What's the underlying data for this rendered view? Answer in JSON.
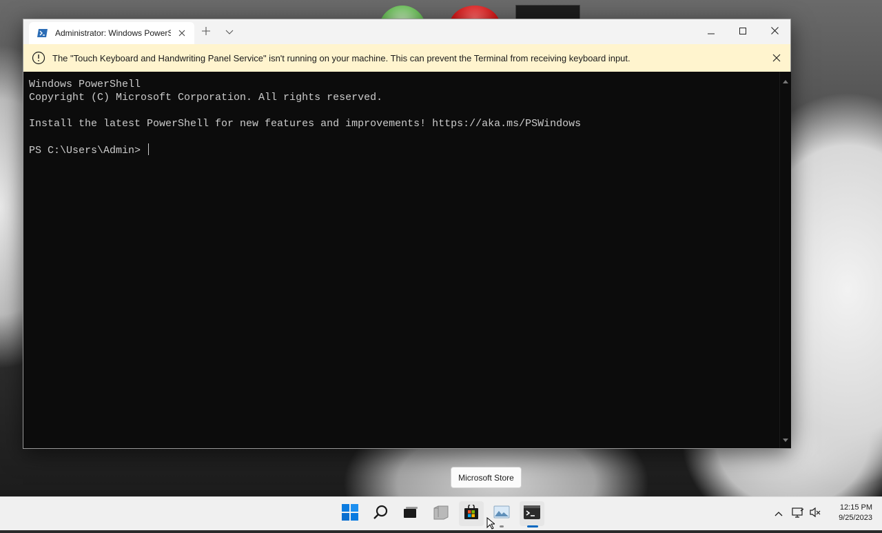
{
  "window": {
    "tab_title": "Administrator: Windows PowerShell",
    "controls": {
      "minimize": "minimize",
      "maximize": "maximize",
      "close": "close"
    }
  },
  "infobar": {
    "message": "The \"Touch Keyboard and Handwriting Panel Service\" isn't running on your machine. This can prevent the Terminal from receiving keyboard input."
  },
  "console": {
    "lines": [
      "Windows PowerShell",
      "Copyright (C) Microsoft Corporation. All rights reserved.",
      "",
      "Install the latest PowerShell for new features and improvements! https://aka.ms/PSWindows",
      "",
      "PS C:\\Users\\Admin> "
    ]
  },
  "tooltip": {
    "text": "Microsoft Store"
  },
  "taskbar": {
    "apps": [
      "start",
      "search",
      "task-view",
      "file-explorer",
      "microsoft-store",
      "photos",
      "terminal"
    ],
    "clock": {
      "time": "12:15 PM",
      "date": "9/25/2023"
    }
  },
  "colors": {
    "infobar_bg": "#fff4ce",
    "console_bg": "#0c0c0c",
    "console_fg": "#cccccc",
    "accent": "#0067c0"
  }
}
